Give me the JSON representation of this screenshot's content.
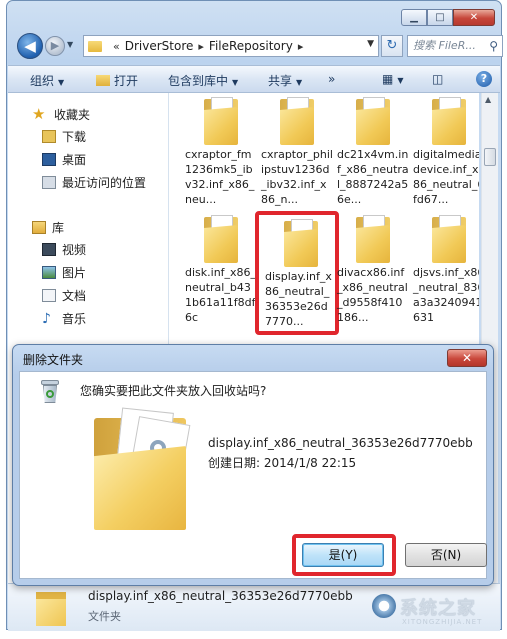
{
  "address": {
    "breadcrumbs": [
      "DriverStore",
      "FileRepository"
    ],
    "search_placeholder": "搜索 FileR..."
  },
  "toolbar": {
    "organize": "组织",
    "open": "打开",
    "include_in_library": "包含到库中",
    "share": "共享",
    "more": "»"
  },
  "nav": {
    "favorites_label": "收藏夹",
    "favorites": [
      "下载",
      "桌面",
      "最近访问的位置"
    ],
    "library_label": "库",
    "libraries": [
      "视频",
      "图片",
      "文档",
      "音乐"
    ]
  },
  "files": [
    {
      "name": "cxraptor_fm1236mk5_ibv32.inf_x86_neu..."
    },
    {
      "name": "cxraptor_philipstuv1236d_ibv32.inf_x86_n..."
    },
    {
      "name": "dc21x4vm.inf_x86_neutral_8887242a56e..."
    },
    {
      "name": "digitalmediadevice.inf_x86_neutral_6fd67..."
    },
    {
      "name": "disk.inf_x86_neutral_b431b61a11f8df6c"
    },
    {
      "name": "display.inf_x86_neutral_36353e26d7770..."
    },
    {
      "name": "divacx86.inf_x86_neutral_d9558f410186..."
    },
    {
      "name": "djsvs.inf_x86_neutral_836a3a3240941631"
    }
  ],
  "details": {
    "name": "display.inf_x86_neutral_36353e26d7770ebb",
    "type": "文件夹"
  },
  "dialog": {
    "title": "删除文件夹",
    "close": "✕",
    "question": "您确实要把此文件夹放入回收站吗?",
    "file_name": "display.inf_x86_neutral_36353e26d7770ebb",
    "created": "创建日期: 2014/1/8 22:15",
    "yes_label": "是(Y)",
    "no_label": "否(N)"
  },
  "watermark": {
    "text": "系统之家",
    "sub": "XITONGZHIJIA.NET"
  },
  "colors": {
    "highlight": "#e0262d",
    "accent": "#3c7fb1"
  }
}
